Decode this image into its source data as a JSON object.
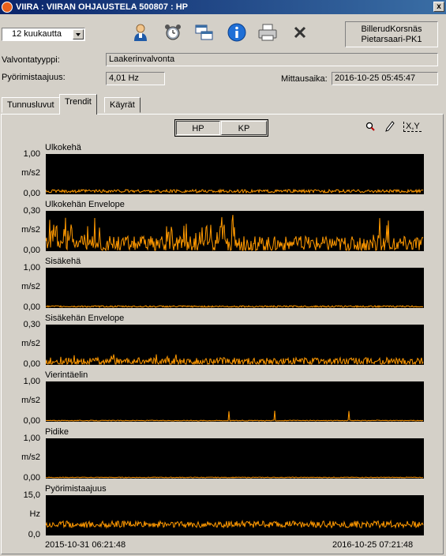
{
  "window": {
    "title": "VIIRA : VIIRAN  OHJAUSTELA 500807 : HP",
    "close": "x"
  },
  "toolbar": {
    "period": "12 kuukautta",
    "icons": [
      "user-icon",
      "alarm-clock-icon",
      "windows-icon",
      "info-icon",
      "printer-icon",
      "close-icon"
    ],
    "plant_line1": "BillerudKorsnäs",
    "plant_line2": "Pietarsaari-PK1"
  },
  "info": {
    "monitoring_type_label": "Valvontatyyppi:",
    "monitoring_type_value": "Laakerinvalvonta",
    "speed_label": "Pyörimistaajuus:",
    "speed_value": "4,01 Hz",
    "measure_time_label": "Mittausaika:",
    "measure_time_value": "2016-10-25    05:45:47"
  },
  "tabs": [
    "Tunnusluvut",
    "Trendit",
    "Käyrät"
  ],
  "active_tab": "Trendit",
  "segments": [
    "HP",
    "KP"
  ],
  "right_tools": {
    "xy": "X,Y"
  },
  "x_axis": {
    "start": "2015-10-31    06:21:48",
    "end": "2016-10-25    07:21:48"
  },
  "chart_data": [
    {
      "type": "line",
      "title": "Ulkokehä",
      "unit": "m/s2",
      "yticks": [
        "1,00",
        "0,00"
      ],
      "ylim": [
        0,
        1
      ],
      "color": "#ff9900",
      "level": 0.06,
      "noise": 0.04,
      "seed": 1
    },
    {
      "type": "line",
      "title": "Ulkokehän Envelope",
      "unit": "m/s2",
      "yticks": [
        "0,30",
        "0,00"
      ],
      "ylim": [
        0,
        0.3
      ],
      "color": "#ff9900",
      "level": 0.05,
      "noise": 0.06,
      "seed": 2
    },
    {
      "type": "line",
      "title": "Sisäkehä",
      "unit": "m/s2",
      "yticks": [
        "1,00",
        "0,00"
      ],
      "ylim": [
        0,
        1
      ],
      "color": "#ff9900",
      "level": 0.02,
      "noise": 0.02,
      "seed": 3
    },
    {
      "type": "line",
      "title": "Sisäkehän Envelope",
      "unit": "m/s2",
      "yticks": [
        "0,30",
        "0,00"
      ],
      "ylim": [
        0,
        0.3
      ],
      "color": "#ff9900",
      "level": 0.02,
      "noise": 0.03,
      "seed": 4
    },
    {
      "type": "line",
      "title": "Vierintäelin",
      "unit": "m/s2",
      "yticks": [
        "1,00",
        "0,00"
      ],
      "ylim": [
        0,
        1
      ],
      "color": "#ff9900",
      "level": 0.01,
      "noise": 0.01,
      "seed": 5
    },
    {
      "type": "line",
      "title": "Pidike",
      "unit": "m/s2",
      "yticks": [
        "1,00",
        "0,00"
      ],
      "ylim": [
        0,
        1
      ],
      "color": "#ff9900",
      "level": 0.01,
      "noise": 0.01,
      "seed": 6
    },
    {
      "type": "line",
      "title": "Pyörimistaajuus",
      "unit": "Hz",
      "yticks": [
        "15,0",
        "0,0"
      ],
      "ylim": [
        0,
        15
      ],
      "color": "#ff9900",
      "level": 4.0,
      "noise": 1.3,
      "seed": 7
    }
  ]
}
